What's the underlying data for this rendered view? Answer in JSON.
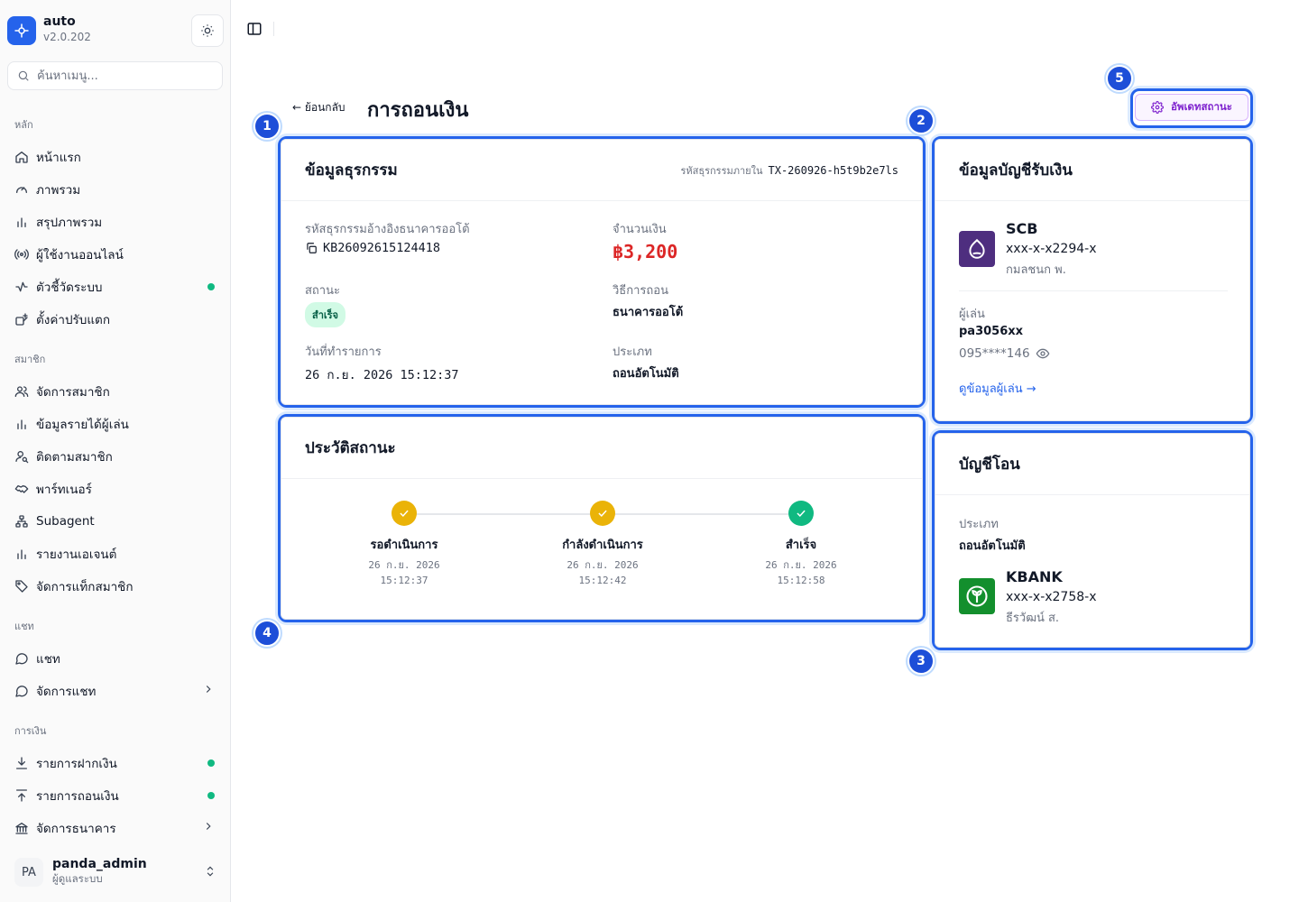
{
  "app": {
    "name": "auto",
    "version": "v2.0.202"
  },
  "search": {
    "placeholder": "ค้นหาเมนู..."
  },
  "sidebar": {
    "groups": [
      {
        "label": "หลัก",
        "items": [
          {
            "label": "หน้าแรก",
            "icon": "home-icon"
          },
          {
            "label": "ภาพรวม",
            "icon": "gauge-icon"
          },
          {
            "label": "สรุปภาพรวม",
            "icon": "bar-chart-icon"
          },
          {
            "label": "ผู้ใช้งานออนไลน์",
            "icon": "broadcast-icon"
          },
          {
            "label": "ตัวชี้วัดระบบ",
            "icon": "activity-icon",
            "dot": true
          },
          {
            "label": "ตั้งค่าปรับแตก",
            "icon": "box-plus-icon"
          }
        ]
      },
      {
        "label": "สมาชิก",
        "items": [
          {
            "label": "จัดการสมาชิก",
            "icon": "users-icon"
          },
          {
            "label": "ข้อมูลรายได้ผู้เล่น",
            "icon": "bar-chart-icon"
          },
          {
            "label": "ติดตามสมาชิก",
            "icon": "user-search-icon"
          },
          {
            "label": "พาร์ทเนอร์",
            "icon": "handshake-icon"
          },
          {
            "label": "Subagent",
            "icon": "network-icon"
          },
          {
            "label": "รายงานเอเจนต์",
            "icon": "bar-chart-icon"
          },
          {
            "label": "จัดการแท็กสมาชิก",
            "icon": "tag-icon"
          }
        ]
      },
      {
        "label": "แชท",
        "items": [
          {
            "label": "แชท",
            "icon": "chat-icon"
          },
          {
            "label": "จัดการแชท",
            "icon": "chat-icon",
            "chevron": true
          }
        ]
      },
      {
        "label": "การเงิน",
        "items": [
          {
            "label": "รายการฝากเงิน",
            "icon": "download-icon",
            "dot": true
          },
          {
            "label": "รายการถอนเงิน",
            "icon": "upload-icon",
            "dot": true
          },
          {
            "label": "จัดการธนาคาร",
            "icon": "bank-icon",
            "chevron": true
          }
        ]
      }
    ]
  },
  "user": {
    "initials": "PA",
    "name": "panda_admin",
    "role": "ผู้ดูแลระบบ"
  },
  "header": {
    "back_label": "← ย้อนกลับ",
    "title": "การถอนเงิน",
    "update_button": "อัพเดทสถานะ"
  },
  "badges": [
    "1",
    "2",
    "3",
    "4",
    "5"
  ],
  "transaction": {
    "title": "ข้อมูลธุรกรรม",
    "internal_ref_label": "รหัสธุรกรรมภายใน",
    "internal_ref": "TX-260926-h5t9b2e7ls",
    "bank_ref_label": "รหัสธุรกรรมอ้างอิงธนาคารออโต้",
    "bank_ref": "KB26092615124418",
    "amount_label": "จำนวนเงิน",
    "amount": "฿3,200",
    "status_label": "สถานะ",
    "status": "สำเร็จ",
    "method_label": "วิธีการถอน",
    "method": "ธนาคารออโต้",
    "date_label": "วันที่ทำรายการ",
    "date": "26 ก.ย. 2026 15:12:37",
    "type_label": "ประเภท",
    "type": "ถอนอัตโนมัติ"
  },
  "history": {
    "title": "ประวัติสถานะ",
    "steps": [
      {
        "label": "รอดำเนินการ",
        "date": "26 ก.ย. 2026",
        "time": "15:12:37",
        "color": "#eab308"
      },
      {
        "label": "กำลังดำเนินการ",
        "date": "26 ก.ย. 2026",
        "time": "15:12:42",
        "color": "#eab308"
      },
      {
        "label": "สำเร็จ",
        "date": "26 ก.ย. 2026",
        "time": "15:12:58",
        "color": "#10b981"
      }
    ]
  },
  "receiver": {
    "title": "ข้อมูลบัญชีรับเงิน",
    "bank": "SCB",
    "account": "xxx-x-x2294-x",
    "holder": "กมลชนก พ.",
    "bank_color": "#4e2e7f",
    "player_label": "ผู้เล่น",
    "player": "pa3056xx",
    "phone": "095****146",
    "view_link": "ดูข้อมูลผู้เล่น →"
  },
  "transfer": {
    "title": "บัญชีโอน",
    "type_label": "ประเภท",
    "type": "ถอนอัตโนมัติ",
    "bank": "KBANK",
    "account": "xxx-x-x2758-x",
    "holder": "ธีรวัฒน์ ส.",
    "bank_color": "#138f2d"
  },
  "colors": {
    "accent": "#2563eb",
    "amount": "#dc2626",
    "success": "#10b981",
    "pending": "#eab308",
    "update_button": "#7e22ce"
  }
}
